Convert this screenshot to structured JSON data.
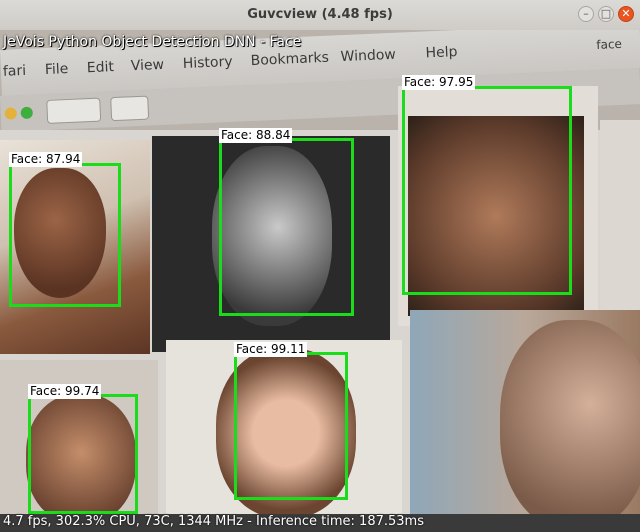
{
  "window": {
    "title": "Guvcview (4.48 fps)",
    "buttons": {
      "minimize": "–",
      "maximize": "□",
      "close": "✕"
    }
  },
  "overlay": {
    "top_text": "JeVois Python Object Detection DNN - Face",
    "bottom_text": "4.7 fps, 302.3% CPU, 73C, 1344 MHz - Inference time: 187.53ms"
  },
  "browser_menu": {
    "items": [
      "fari",
      "File",
      "Edit",
      "View",
      "History",
      "Bookmarks",
      "Window",
      "Help"
    ],
    "search_text": "face"
  },
  "detections": [
    {
      "label": "Face: 87.94"
    },
    {
      "label": "Face: 88.84"
    },
    {
      "label": "Face: 97.95"
    },
    {
      "label": "Face: 99.11"
    },
    {
      "label": "Face: 99.74"
    }
  ]
}
